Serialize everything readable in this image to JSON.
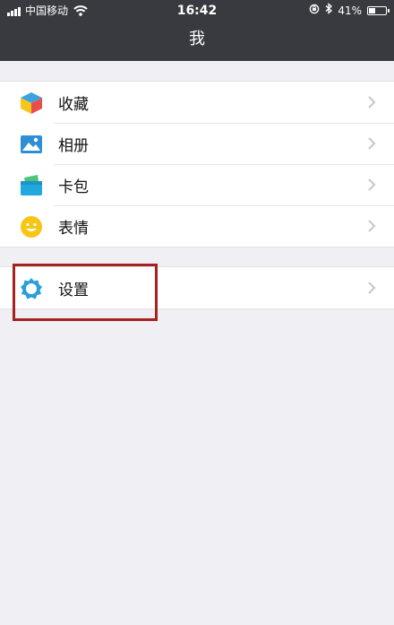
{
  "status_bar": {
    "carrier": "中国移动",
    "time": "16:42",
    "battery_percent": "41%",
    "battery_level": 0.41
  },
  "nav": {
    "title": "我"
  },
  "menu": {
    "items": [
      {
        "label": "收藏",
        "icon": "favorites-cube-icon"
      },
      {
        "label": "相册",
        "icon": "album-icon"
      },
      {
        "label": "卡包",
        "icon": "card-wallet-icon"
      },
      {
        "label": "表情",
        "icon": "emoji-smiley-icon"
      }
    ],
    "settings": {
      "label": "设置",
      "icon": "settings-gear-icon"
    }
  },
  "colors": {
    "nav_bar": "#393a3f",
    "background": "#efeff4",
    "highlight": "#a52220",
    "settings_icon": "#2a9fd8"
  }
}
